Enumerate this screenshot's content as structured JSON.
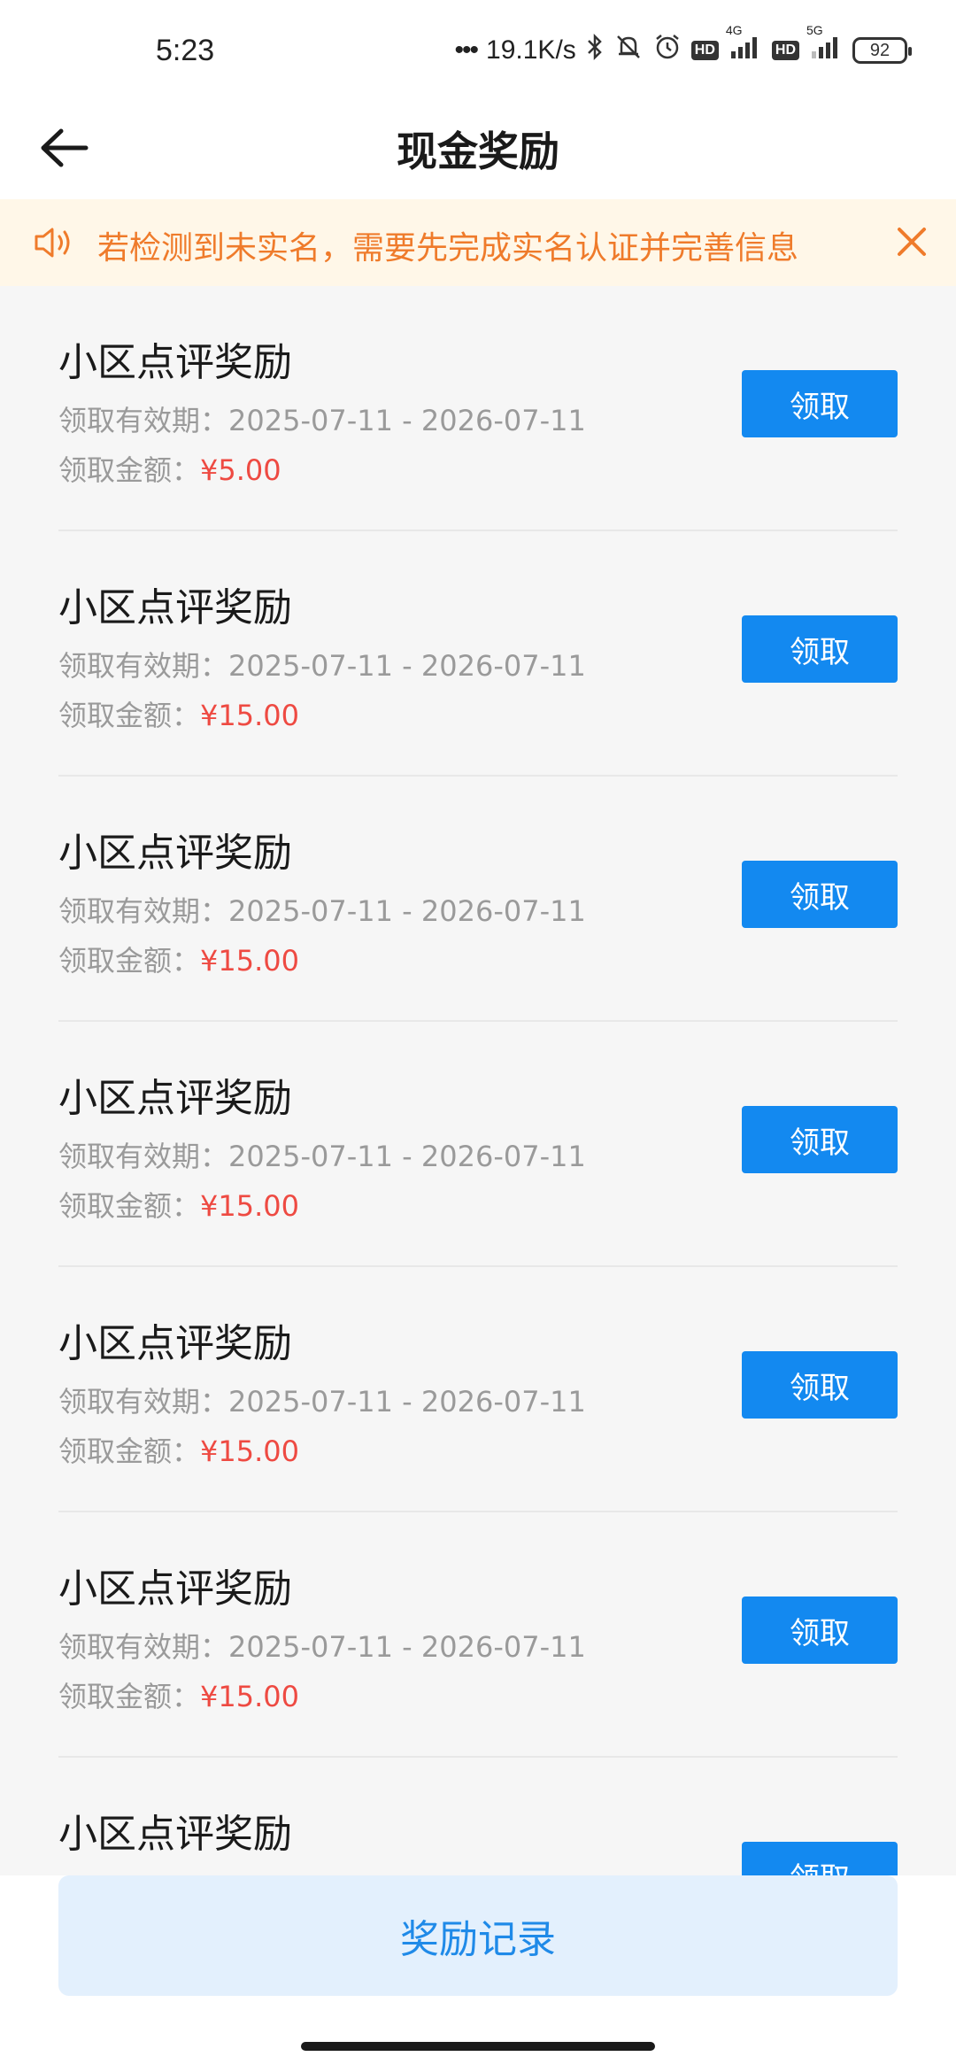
{
  "status_bar": {
    "time": "5:23",
    "dots": "•••",
    "net_speed": "19.1K/s",
    "hd_label": "HD",
    "net_4g": "4G",
    "net_5g": "5G",
    "battery": "92"
  },
  "header": {
    "title": "现金奖励",
    "back_icon": "arrow-left-icon"
  },
  "notice": {
    "text": "若检测到未实名，需要先完成实名认证并完善信息",
    "icon": "speaker-icon",
    "close_icon": "close-icon",
    "color": "#ef7b2b",
    "background": "#fff7e8"
  },
  "rewards": [
    {
      "title": "小区点评奖励",
      "validity_label": "领取有效期：",
      "validity": "2025-07-11 - 2026-07-11",
      "amount_label": "领取金额：",
      "amount": "¥5.00",
      "button": "领取"
    },
    {
      "title": "小区点评奖励",
      "validity_label": "领取有效期：",
      "validity": "2025-07-11 - 2026-07-11",
      "amount_label": "领取金额：",
      "amount": "¥15.00",
      "button": "领取"
    },
    {
      "title": "小区点评奖励",
      "validity_label": "领取有效期：",
      "validity": "2025-07-11 - 2026-07-11",
      "amount_label": "领取金额：",
      "amount": "¥15.00",
      "button": "领取"
    },
    {
      "title": "小区点评奖励",
      "validity_label": "领取有效期：",
      "validity": "2025-07-11 - 2026-07-11",
      "amount_label": "领取金额：",
      "amount": "¥15.00",
      "button": "领取"
    },
    {
      "title": "小区点评奖励",
      "validity_label": "领取有效期：",
      "validity": "2025-07-11 - 2026-07-11",
      "amount_label": "领取金额：",
      "amount": "¥15.00",
      "button": "领取"
    },
    {
      "title": "小区点评奖励",
      "validity_label": "领取有效期：",
      "validity": "2025-07-11 - 2026-07-11",
      "amount_label": "领取金额：",
      "amount": "¥15.00",
      "button": "领取"
    },
    {
      "title": "小区点评奖励",
      "button": "领取"
    }
  ],
  "bottom": {
    "record_button": "奖励记录"
  },
  "colors": {
    "primary_button": "#1389f0",
    "amount": "#ee4a42",
    "record_button_bg": "#e3f0fd",
    "record_button_text": "#1f8ae8"
  }
}
